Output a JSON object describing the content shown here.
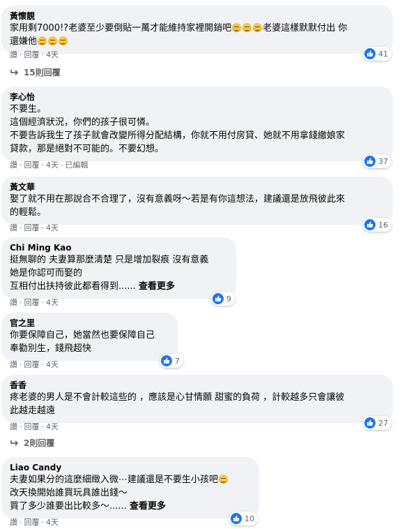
{
  "comments": [
    {
      "author": "黃懷靚",
      "lines": [
        "家用剩7000!?老婆至少要倒貼一萬才能維持家裡開銷吧",
        "老婆這樣默默付出 你",
        "還嫌他"
      ],
      "likes": "41",
      "actions": {
        "like": "讚",
        "reply": "回覆",
        "time": "4天"
      },
      "replies": "15則回覆"
    },
    {
      "author": "李心怡",
      "lines": [
        "不要生。",
        "這個經濟狀況，你們的孩子很可憐。",
        "不要告訴我生了孩子就會改變所得分配結構，你就不用付房貸、她就不用拿錢繳娘家",
        "貸款，那是絕對不可能的。不要幻想。"
      ],
      "likes": "37",
      "actions": {
        "like": "讚",
        "reply": "回覆",
        "time": "4天",
        "edited": "已編輯"
      }
    },
    {
      "author": "黃文華",
      "lines": [
        "娶了就不用在那說合不合理了，沒有意義呀～若是有你這想法，建議還是放飛彼此來",
        "的輕鬆。"
      ],
      "likes": "16",
      "actions": {
        "like": "讚",
        "reply": "回覆",
        "time": "4天"
      }
    },
    {
      "author": "Chi Ming Kao",
      "lines": [
        "挺無聊的 夫妻算那麼清楚 只是增加裂痕 沒有意義",
        "她是你認可而娶的",
        "互相付出扶持彼此都看得到......"
      ],
      "see_more": "查看更多",
      "likes": "9",
      "actions": {
        "like": "讚",
        "reply": "回覆",
        "time": "4天"
      }
    },
    {
      "author": "官之里",
      "lines": [
        "你要保障自己，她當然也要保障自己",
        "奉勸別生，錢飛超快"
      ],
      "likes": "7",
      "actions": {
        "like": "讚",
        "reply": "回覆",
        "time": "4天"
      }
    },
    {
      "author": "香香",
      "lines": [
        "疼老婆的男人是不會計較這些的 ，應該是心甘情願 甜蜜的負荷 ，計較越多只會讓彼",
        "此越走越遠"
      ],
      "likes": "27",
      "actions": {
        "like": "讚",
        "reply": "回覆",
        "time": "4天"
      },
      "replies": "2則回覆"
    },
    {
      "author": "Liao Candy",
      "lines": [
        "夫妻如果分的這麼細緻入微⋯建議還是不要生小孩吧",
        "改天換開始誰買玩具誰出錢～",
        "買了多少誰要出比較多～......"
      ],
      "see_more": "查看更多",
      "likes": "10",
      "actions": {
        "like": "讚",
        "reply": "回覆",
        "time": "4天"
      }
    }
  ],
  "icons": {
    "like": "thumbs-up-icon",
    "emoji": "pensive-face-emoji",
    "reply_arrow": "reply-arrow-icon"
  },
  "colors": {
    "bubble": "#f0f2f5",
    "like_blue": "#1877f2",
    "meta_gray": "#65676b"
  }
}
